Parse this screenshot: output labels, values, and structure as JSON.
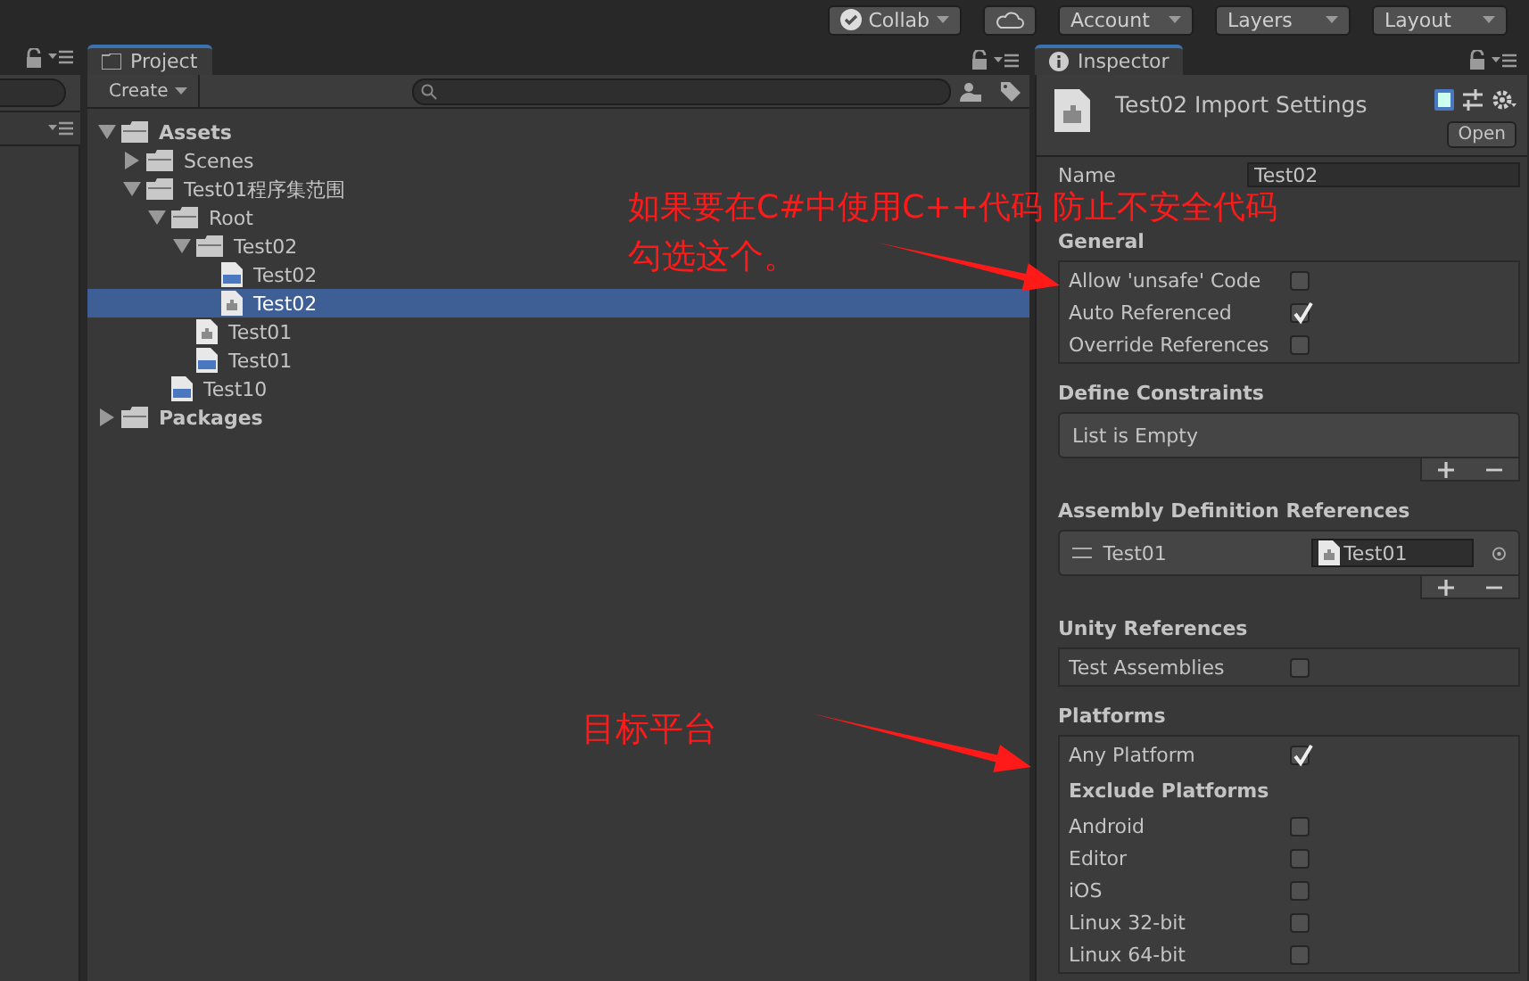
{
  "toolbar": {
    "buttons": [
      {
        "kind": "collab",
        "label": "Collab"
      },
      {
        "kind": "cloud"
      },
      {
        "kind": "dropdown",
        "label": "Account"
      },
      {
        "kind": "dropdown",
        "label": "Layers"
      },
      {
        "kind": "dropdown",
        "label": "Layout"
      }
    ]
  },
  "project": {
    "tab": "Project",
    "create": "Create",
    "tree": [
      {
        "kind": "folder",
        "label": "Assets",
        "expanded": true,
        "selected": false,
        "children": [
          {
            "kind": "folder",
            "label": "Scenes",
            "expanded": false,
            "selected": false
          },
          {
            "kind": "folder",
            "label": "Test01程序集范围",
            "expanded": true,
            "selected": false,
            "children": [
              {
                "kind": "folder",
                "label": "Root",
                "expanded": true,
                "selected": false,
                "children": [
                  {
                    "kind": "folder",
                    "label": "Test02",
                    "expanded": true,
                    "selected": false,
                    "children": [
                      {
                        "kind": "script",
                        "label": "Test02",
                        "selected": false
                      },
                      {
                        "kind": "asmdef",
                        "label": "Test02",
                        "selected": true
                      }
                    ]
                  },
                  {
                    "kind": "asmdef",
                    "label": "Test01",
                    "selected": false
                  },
                  {
                    "kind": "script",
                    "label": "Test01",
                    "selected": false
                  }
                ]
              },
              {
                "kind": "script",
                "label": "Test10",
                "selected": false
              }
            ]
          }
        ]
      },
      {
        "kind": "folder",
        "label": "Packages",
        "expanded": false,
        "selected": false
      }
    ]
  },
  "inspector": {
    "tab": "Inspector",
    "title": "Test02 Import Settings",
    "open_button": "Open",
    "name_label": "Name",
    "name_value": "Test02",
    "sections": [
      {
        "kind": "toggles",
        "title": "General",
        "rows": [
          {
            "kind": "toggle",
            "label": "Allow 'unsafe' Code",
            "checked": false
          },
          {
            "kind": "toggle",
            "label": "Auto Referenced",
            "checked": true
          },
          {
            "kind": "toggle",
            "label": "Override References",
            "checked": false
          }
        ]
      },
      {
        "kind": "list",
        "title": "Define Constraints",
        "empty_text": "List is Empty"
      },
      {
        "kind": "references",
        "title": "Assembly Definition References",
        "items": [
          {
            "name": "Test01",
            "field": "Test01"
          }
        ]
      },
      {
        "kind": "toggles",
        "title": "Unity References",
        "rows": [
          {
            "kind": "toggle",
            "label": "Test Assemblies",
            "checked": false
          }
        ]
      },
      {
        "kind": "toggles",
        "title": "Platforms",
        "rows": [
          {
            "kind": "toggle",
            "label": "Any Platform",
            "checked": true
          },
          {
            "kind": "heading",
            "label": "Exclude Platforms"
          },
          {
            "kind": "toggle",
            "label": "Android",
            "checked": false
          },
          {
            "kind": "toggle",
            "label": "Editor",
            "checked": false
          },
          {
            "kind": "toggle",
            "label": "iOS",
            "checked": false
          },
          {
            "kind": "toggle",
            "label": "Linux 32-bit",
            "checked": false
          },
          {
            "kind": "toggle",
            "label": "Linux 64-bit",
            "checked": false
          }
        ]
      }
    ]
  },
  "annotations": [
    {
      "lines": [
        "如果要在C#中使用C++代码 防止不安全代码",
        "勾选这个。"
      ]
    },
    {
      "lines": [
        "目标平台"
      ]
    }
  ]
}
